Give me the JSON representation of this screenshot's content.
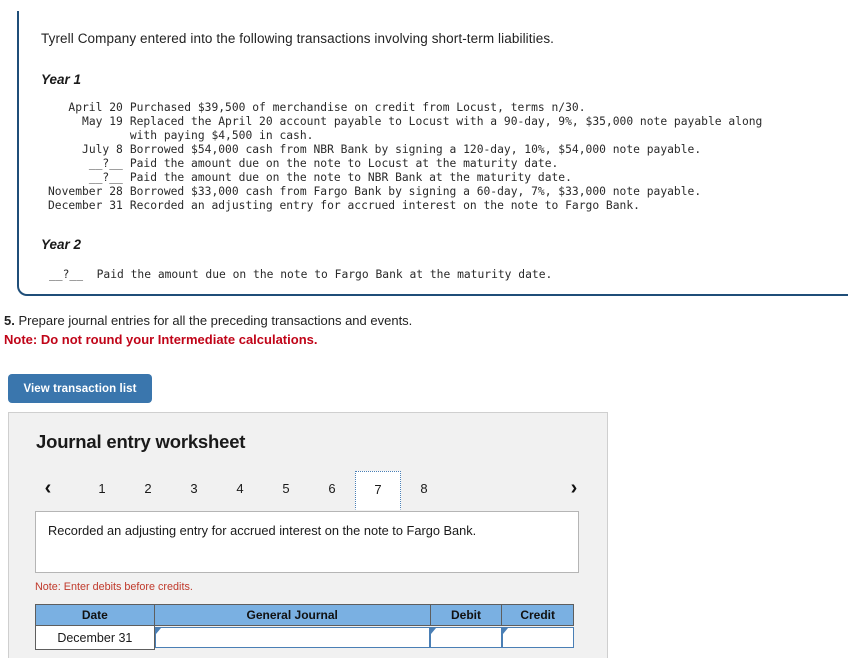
{
  "problem": {
    "intro": "Tyrell Company entered into the following transactions involving short-term liabilities.",
    "year1_label": "Year 1",
    "year2_label": "Year 2",
    "year1_transactions": [
      {
        "date": "April 20",
        "desc": "Purchased $39,500 of merchandise on credit from Locust, terms n/30."
      },
      {
        "date": "May 19",
        "desc": "Replaced the April 20 account payable to Locust with a 90-day, 9%, $35,000 note payable along\nwith paying $4,500 in cash."
      },
      {
        "date": "July 8",
        "desc": "Borrowed $54,000 cash from NBR Bank by signing a 120-day, 10%, $54,000 note payable."
      },
      {
        "date": "__?__",
        "desc": "Paid the amount due on the note to Locust at the maturity date."
      },
      {
        "date": "__?__",
        "desc": "Paid the amount due on the note to NBR Bank at the maturity date."
      },
      {
        "date": "November 28",
        "desc": "Borrowed $33,000 cash from Fargo Bank by signing a 60-day, 7%, $33,000 note payable."
      },
      {
        "date": "December 31",
        "desc": "Recorded an adjusting entry for accrued interest on the note to Fargo Bank."
      }
    ],
    "year2_transaction": "__?__  Paid the amount due on the note to Fargo Bank at the maturity date."
  },
  "requirement": {
    "number": "5.",
    "text": " Prepare journal entries for all the preceding transactions and events.",
    "note": "Note: Do not round your Intermediate calculations."
  },
  "toolbar": {
    "view_transaction_list_label": "View transaction list"
  },
  "worksheet": {
    "title": "Journal entry worksheet",
    "prev_icon": "chevron-left-icon",
    "next_icon": "chevron-right-icon",
    "prev_label": "‹",
    "next_label": "›",
    "tabs": [
      "1",
      "2",
      "3",
      "4",
      "5",
      "6",
      "7",
      "8"
    ],
    "active_tab": "7",
    "description": "Recorded an adjusting entry for accrued interest on the note to Fargo Bank.",
    "debits_note": "Note: Enter debits before credits.",
    "table": {
      "headers": [
        "Date",
        "General Journal",
        "Debit",
        "Credit"
      ],
      "rows": [
        {
          "date": "December 31",
          "general_journal": "",
          "debit": "",
          "credit": ""
        }
      ]
    }
  },
  "colors": {
    "panel_border": "#1f4e79",
    "button_blue": "#3a76ad",
    "header_blue": "#7ab0e2",
    "note_red": "#c00418",
    "debits_note_red": "#c0392b",
    "input_border_blue": "#4a7fb5"
  }
}
